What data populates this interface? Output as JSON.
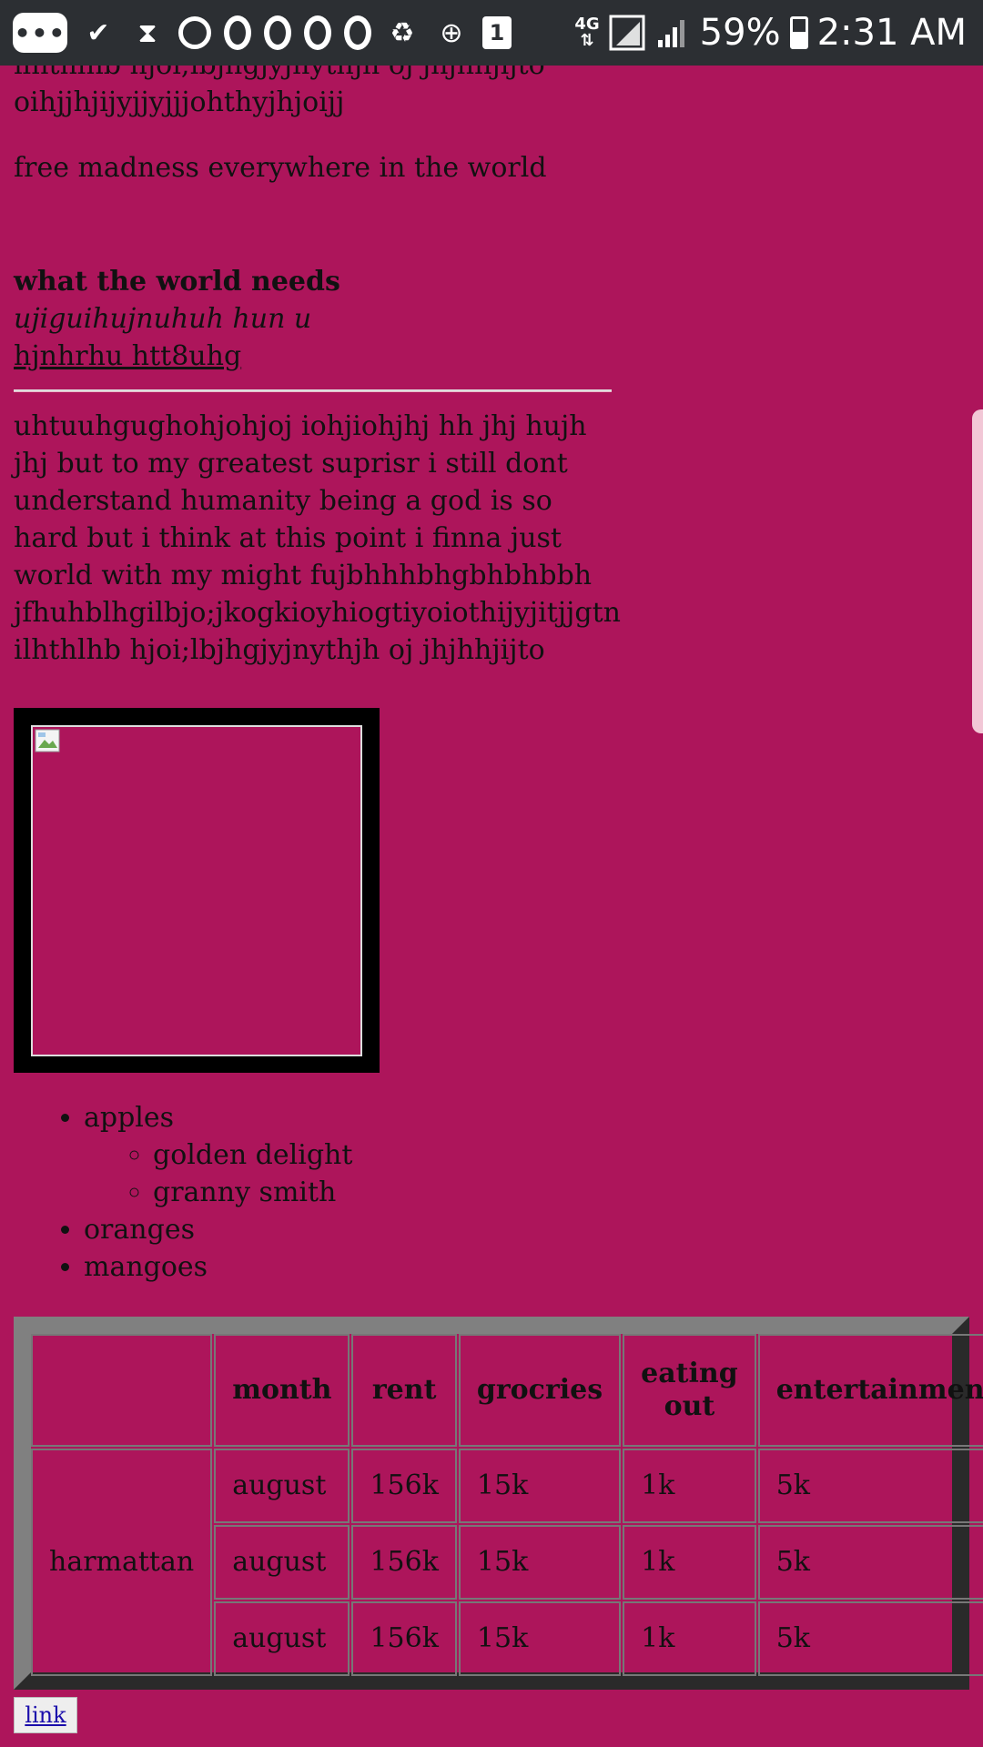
{
  "status_bar": {
    "left_icons": [
      "dots-icon",
      "check-icon",
      "hourglass-icon",
      "sync-icon",
      "circle-icon",
      "circle-icon",
      "circle-icon",
      "circle-icon",
      "recycle-battery-icon",
      "add-circle-icon",
      "one-box-icon"
    ],
    "network": "4G",
    "battery_text": "59%",
    "time": "2:31 AM"
  },
  "article": {
    "top_lines": "ilhthlhb hjoi;lbjhgjyjnythjh oj jhjhhjijto oihjjhjijyjjyjjjohthyjhjoijj",
    "free_line": "free madness everywhere in the world",
    "heading_bold": "what the world needs",
    "heading_italic": "ujiguihujnuhuh hun u",
    "heading_underline": "hjnhrhu htt8uhg",
    "long_paragraph": "uhtuuhgughohjohjoj iohjiohjhj hh jhj hujh jhj but to my greatest suprisr i still dont understand humanity being a god is so hard but i think at this point i finna just world with my might fujbhhhbhgbhbhbbh jfhuhblhgilbjo;jkogkioyhiogtiyoiothijyjitjjgtn ilhthlhb hjoi;lbjhgjyjnythjh oj jhjhhjijto"
  },
  "fruit_list": {
    "apples": "apples",
    "apple_varieties": [
      "golden delight",
      "granny smith"
    ],
    "oranges": "oranges",
    "mangoes": "mangoes"
  },
  "table": {
    "headers": [
      "",
      "month",
      "rent",
      "grocries",
      "eating out",
      "entertainment"
    ],
    "season": "harmattan",
    "rows": [
      [
        "august",
        "156k",
        "15k",
        "1k",
        "5k"
      ],
      [
        "august",
        "156k",
        "15k",
        "1k",
        "5k"
      ],
      [
        "august",
        "156k",
        "15k",
        "1k",
        "5k"
      ]
    ]
  },
  "link_label": "link"
}
